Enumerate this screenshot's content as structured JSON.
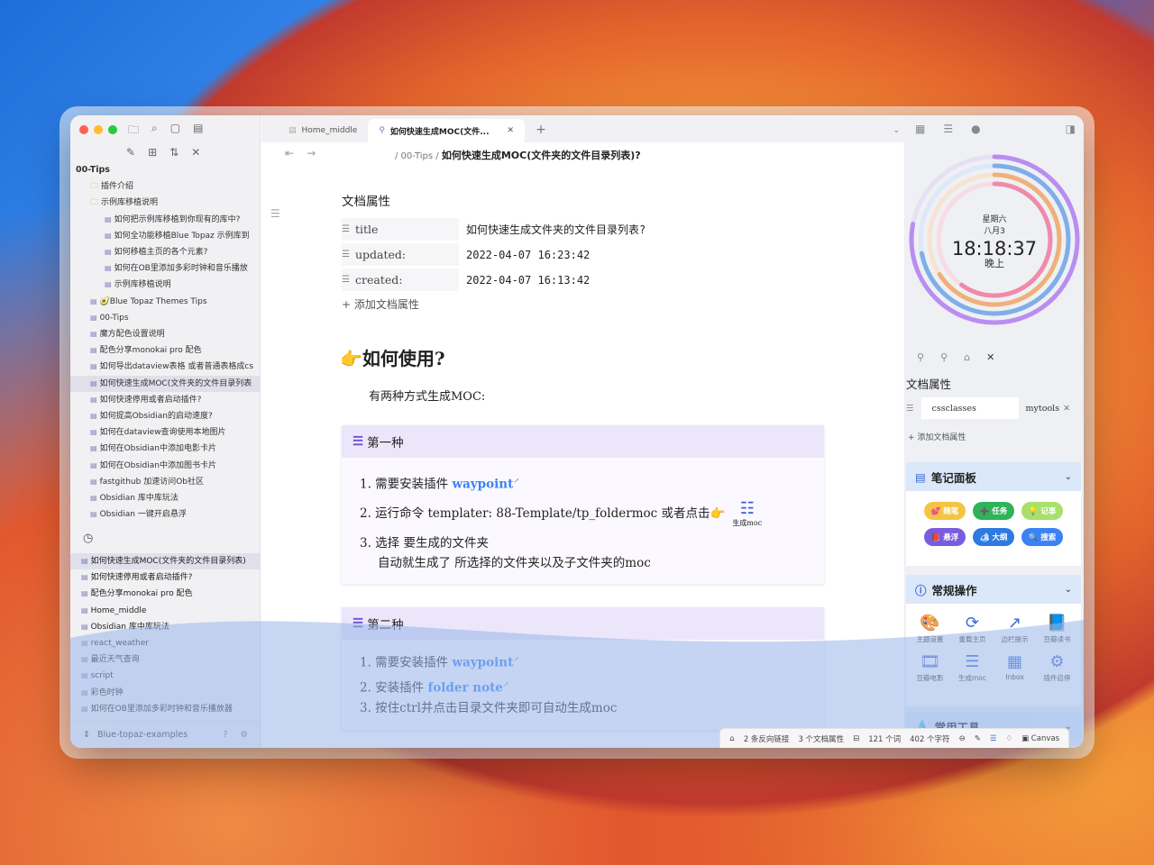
{
  "sidebar": {
    "root": "00-Tips",
    "tree": [
      {
        "level": "l1",
        "kind": "folder",
        "label": "插件介绍"
      },
      {
        "level": "l1",
        "kind": "folder",
        "label": "示例库移植说明"
      },
      {
        "level": "l2",
        "kind": "file",
        "label": "如何把示例库移植到你现有的库中?"
      },
      {
        "level": "l2",
        "kind": "file",
        "label": "如何全功能移植Blue Topaz 示例库到"
      },
      {
        "level": "l2",
        "kind": "file",
        "label": "如何移植主页的各个元素?"
      },
      {
        "level": "l2",
        "kind": "file",
        "label": "如何在OB里添加多彩时钟和音乐播放"
      },
      {
        "level": "l2",
        "kind": "file",
        "label": "示例库移植说明"
      },
      {
        "level": "l1",
        "kind": "file",
        "label": "🥑Blue Topaz Themes Tips"
      },
      {
        "level": "l1",
        "kind": "file",
        "label": "00-Tips"
      },
      {
        "level": "l1",
        "kind": "file",
        "label": "魔方配色设置说明"
      },
      {
        "level": "l1",
        "kind": "file",
        "label": "配色分享monokai pro 配色"
      },
      {
        "level": "l1",
        "kind": "file",
        "label": "如何导出dataview表格 或者普通表格成cs"
      },
      {
        "level": "l1",
        "kind": "file",
        "label": "如何快速生成MOC(文件夹的文件目录列表",
        "selected": true
      },
      {
        "level": "l1",
        "kind": "file",
        "label": "如何快速停用或者启动插件?"
      },
      {
        "level": "l1",
        "kind": "file",
        "label": "如何提高Obsidian的启动速度?"
      },
      {
        "level": "l1",
        "kind": "file",
        "label": "如何在dataview查询使用本地图片"
      },
      {
        "level": "l1",
        "kind": "file",
        "label": "如何在Obsidian中添加电影卡片"
      },
      {
        "level": "l1",
        "kind": "file",
        "label": "如何在Obsidian中添加图书卡片"
      },
      {
        "level": "l1",
        "kind": "file",
        "label": "fastgithub 加速访问Ob社区"
      },
      {
        "level": "l1",
        "kind": "file",
        "label": "Obsidian 库中库玩法"
      },
      {
        "level": "l1",
        "kind": "file",
        "label": "Obsidian 一键开启悬浮"
      }
    ],
    "recent": [
      {
        "label": "如何快速生成MOC(文件夹的文件目录列表)",
        "selected": true
      },
      {
        "label": "如何快速停用或者启动插件?"
      },
      {
        "label": "配色分享monokai pro 配色"
      },
      {
        "label": "Home_middle"
      },
      {
        "label": "Obsidian 库中库玩法"
      },
      {
        "label": "react_weather"
      },
      {
        "label": "最近天气查询"
      },
      {
        "label": "script"
      },
      {
        "label": "彩色时钟"
      },
      {
        "label": "如何在OB里添加多彩时钟和音乐播放器"
      }
    ],
    "vault": "Blue-topaz-examples"
  },
  "tabs": [
    {
      "label": "Home_middle",
      "active": false
    },
    {
      "label": "如何快速生成MOC(文件...",
      "active": true
    }
  ],
  "breadcrumb": {
    "parent": "/ 00-Tips /",
    "current": "如何快速生成MOC(文件夹的文件目录列表)?"
  },
  "doc": {
    "props_title": "文档属性",
    "props": [
      {
        "key": "title",
        "value": "如何快速生成文件夹的文件目录列表?"
      },
      {
        "key": "updated:",
        "value": "2022-04-07 16:23:42"
      },
      {
        "key": "created:",
        "value": "2022-04-07 16:13:42"
      }
    ],
    "add_prop": "+ 添加文档属性",
    "heading": "👉如何使用?",
    "intro": "有两种方式生成MOC:",
    "callout1": {
      "title": "第一种",
      "item1_pre": "1. 需要安装插件 ",
      "item1_link": "waypoint",
      "item2": "2. 运行命令 templater: 88-Template/tp_foldermoc 或者点击👉",
      "moc_label": "生成moc",
      "item3a": "3. 选择 要生成的文件夹",
      "item3b": "自动就生成了 所选择的文件夹以及子文件夹的moc"
    },
    "callout2": {
      "title": "第二种",
      "item1_pre": "1. 需要安装插件 ",
      "item1_link": "waypoint",
      "item2_pre": "2. 安装插件 ",
      "item2_link": "folder note",
      "item3": "3. 按住ctrl并点击目录文件夹即可自动生成moc"
    }
  },
  "right": {
    "clock": {
      "weekday": "星期六",
      "date": "八月3",
      "time": "18:18:37",
      "period": "晚上",
      "rings": [
        0.78,
        0.72,
        0.66,
        0.6
      ]
    },
    "props_title": "文档属性",
    "prop_key": "cssclasses",
    "prop_val": "mytools",
    "add_prop": "+ 添加文档属性",
    "notes_panel": {
      "title": "笔记面板",
      "chips": [
        {
          "label": "💕 随笔",
          "color": "#f4c542"
        },
        {
          "label": "➕ 任务",
          "color": "#2fb35a"
        },
        {
          "label": "💡 记事",
          "color": "#a8e06a"
        },
        {
          "label": "📕 悬浮",
          "color": "#7b5ce0"
        },
        {
          "label": "🏕 大纲",
          "color": "#2d7be0"
        },
        {
          "label": "🔍 搜索",
          "color": "#3b82f6"
        }
      ]
    },
    "ops_panel": {
      "title": "常规操作",
      "tools": [
        {
          "icon": "🎨",
          "label": "主题设置"
        },
        {
          "icon": "⟳",
          "label": "重载主页"
        },
        {
          "icon": "↗",
          "label": "边栏提示"
        },
        {
          "icon": "📘",
          "label": "豆瓣读书"
        },
        {
          "icon": "🎞",
          "label": "豆瓣电影"
        },
        {
          "icon": "☰",
          "label": "生成moc"
        },
        {
          "icon": "▦",
          "label": "Inbox"
        },
        {
          "icon": "⚙",
          "label": "插件启停"
        }
      ]
    },
    "common_panel": {
      "title": "常用工具"
    }
  },
  "status": {
    "backlinks": "2 条反向链接",
    "props": "3 个文档属性",
    "words": "121 个词",
    "chars": "402 个字符",
    "canvas": "Canvas"
  }
}
